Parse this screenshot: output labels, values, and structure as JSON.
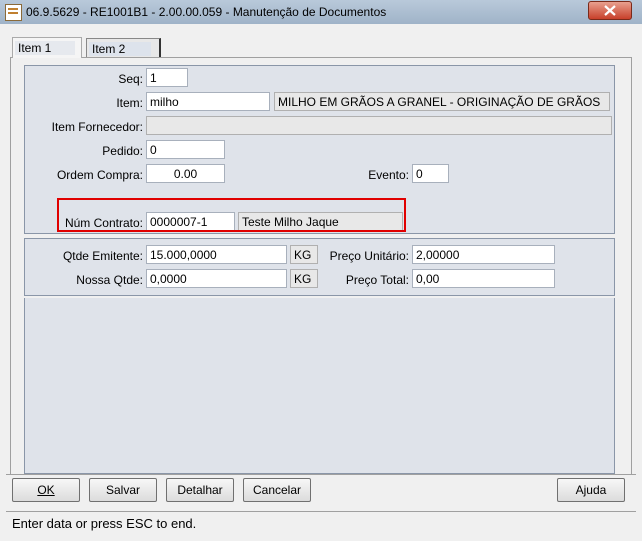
{
  "window": {
    "title": "06.9.5629 - RE1001B1 - 2.00.00.059 - Manutenção de Documentos"
  },
  "tabs": [
    {
      "label": "Item 1"
    },
    {
      "label": "Item 2"
    }
  ],
  "form": {
    "seq_label": "Seq:",
    "seq_value": "1",
    "item_label": "Item:",
    "item_value": "milho",
    "item_desc": "MILHO EM GRÃOS A GRANEL - ORIGINAÇÃO DE GRÃOS",
    "item_fornecedor_label": "Item Fornecedor:",
    "item_fornecedor_value": "",
    "pedido_label": "Pedido:",
    "pedido_value": "0",
    "ordem_compra_label": "Ordem Compra:",
    "ordem_compra_value": "0.00",
    "evento_label": "Evento:",
    "evento_value": "0",
    "num_contrato_label": "Núm Contrato:",
    "num_contrato_value": "0000007-1",
    "num_contrato_desc": "Teste Milho Jaque",
    "qtde_emitente_label": "Qtde Emitente:",
    "qtde_emitente_value": "15.000,0000",
    "qtde_emitente_unit": "KG",
    "nossa_qtde_label": "Nossa Qtde:",
    "nossa_qtde_value": "0,0000",
    "nossa_qtde_unit": "KG",
    "preco_unitario_label": "Preço Unitário:",
    "preco_unitario_value": "2,00000",
    "preco_total_label": "Preço Total:",
    "preco_total_value": "0,00"
  },
  "buttons": {
    "ok_label": "OK",
    "salvar_label": "Salvar",
    "detalhar_label": "Detalhar",
    "cancelar_label": "Cancelar",
    "ajuda_label": "Ajuda"
  },
  "status_bar": {
    "text": "Enter data or press ESC to end."
  },
  "colors": {
    "highlight": "#e00000",
    "panel": "#dfe3ea"
  }
}
